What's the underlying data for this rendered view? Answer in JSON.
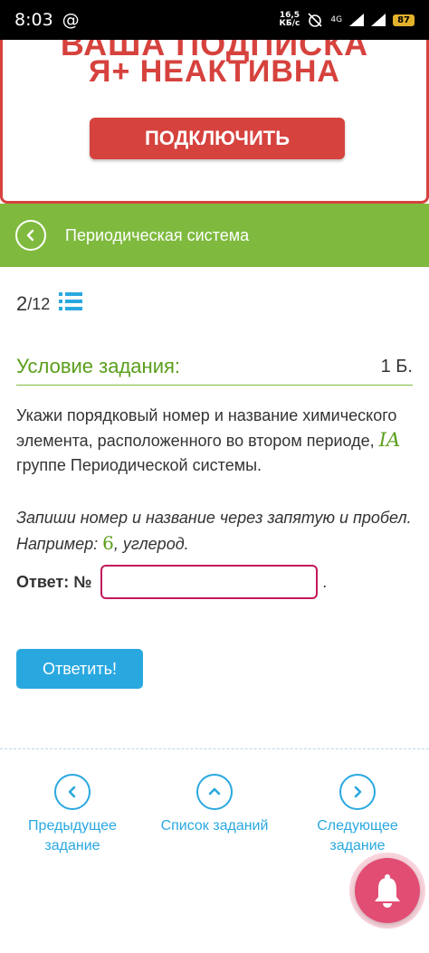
{
  "status_bar": {
    "time": "8:03",
    "at_symbol": "@",
    "speed_value": "16,5",
    "speed_unit": "КБ/с",
    "network": "4G",
    "battery": "87"
  },
  "promo": {
    "partial_top": "ВАША ПОДПИСКА",
    "title": "Я+ НЕАКТИВНА",
    "button_label": "ПОДКЛЮЧИТЬ"
  },
  "header": {
    "title": "Периодическая система"
  },
  "counter": {
    "current": "2",
    "separator_total": "/12"
  },
  "condition": {
    "title": "Условие задания:",
    "points": "1 Б."
  },
  "task": {
    "text_part1": "Укажи порядковый номер и название химического элемента, расположенного во втором периоде, ",
    "group": "IA",
    "text_part2": " группе Периодической системы."
  },
  "hint": {
    "text_part1": "Запиши номер и название через запятую и пробел. Например: ",
    "example_number": "6",
    "text_part2": ", углерод."
  },
  "answer": {
    "label": "Ответ: №",
    "value": "",
    "placeholder": "",
    "dot": "."
  },
  "submit_label": "Ответить!",
  "navigation": {
    "prev_label": "Предыдущее задание",
    "list_label": "Список заданий",
    "next_label": "Следующее задание"
  },
  "colors": {
    "green": "#7fba3e",
    "blue": "#29a8e0",
    "red": "#d6423d",
    "input_border": "#c2185b",
    "fab": "#e24d73"
  },
  "icons": [
    "back-arrow-icon",
    "list-icon",
    "chevron-left-icon",
    "chevron-up-icon",
    "chevron-right-icon",
    "bell-icon"
  ]
}
